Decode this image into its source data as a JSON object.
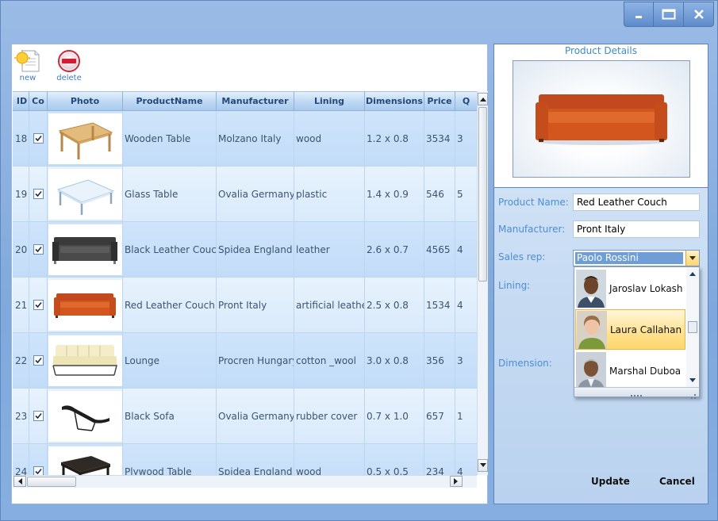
{
  "window": {
    "controls": [
      {
        "icon": "minimize-icon"
      },
      {
        "icon": "maximize-icon"
      },
      {
        "icon": "close-icon"
      }
    ]
  },
  "toolbar": {
    "new_label": "new",
    "delete_label": "delete"
  },
  "grid": {
    "columns": [
      "ID",
      "Co",
      "Photo",
      "ProductName",
      "Manufacturer",
      "Lining",
      "Dimensions",
      "Price",
      "Q"
    ],
    "rows": [
      {
        "id": "18",
        "checked": true,
        "photo": "wooden-table-image",
        "name": "Wooden Table",
        "manufacturer": "Molzano Italy",
        "lining": "wood",
        "dimensions": "1.2 x 0.8",
        "price": "3534",
        "q": "3"
      },
      {
        "id": "19",
        "checked": true,
        "photo": "glass-table-image",
        "name": "Glass Table",
        "manufacturer": "Ovalia Germany",
        "lining": "plastic",
        "dimensions": "1.4 x 0.9",
        "price": "546",
        "q": "5"
      },
      {
        "id": "20",
        "checked": true,
        "photo": "black-couch-image",
        "name": "Black Leather Couch",
        "manufacturer": "Spidea England",
        "lining": "leather",
        "dimensions": "2.6 x 0.7",
        "price": "4565",
        "q": "4"
      },
      {
        "id": "21",
        "checked": true,
        "photo": "red-couch-image",
        "name": "Red Leather Couch",
        "manufacturer": "Pront Italy",
        "lining": "artificial leather",
        "dimensions": "2.5 x 0.8",
        "price": "1534",
        "q": "4"
      },
      {
        "id": "22",
        "checked": true,
        "photo": "lounge-image",
        "name": "Lounge",
        "manufacturer": "Procren Hungary",
        "lining": "cotton _wool",
        "dimensions": "3.0 x 0.8",
        "price": "356",
        "q": "3"
      },
      {
        "id": "23",
        "checked": true,
        "photo": "black-sofa-image",
        "name": "Black Sofa",
        "manufacturer": "Ovalia Germany",
        "lining": "rubber cover",
        "dimensions": "0.7 x 1.0",
        "price": "657",
        "q": "1"
      },
      {
        "id": "24",
        "checked": true,
        "photo": "plywood-table-image",
        "name": "Plywood Table",
        "manufacturer": "Spidea England",
        "lining": "wood",
        "dimensions": "0.5 x 0.5",
        "price": "234",
        "q": "4"
      }
    ]
  },
  "details": {
    "title": "Product Details",
    "image": "red-couch-image",
    "product_name_label": "Product Name:",
    "product_name_value": "Red Leather Couch",
    "manufacturer_label": "Manufacturer:",
    "manufacturer_value": "Pront Italy",
    "sales_rep_label": "Sales rep:",
    "sales_rep_value": "Paolo Rossini",
    "lining_label": "Lining:",
    "dimension_label": "Dimension:",
    "sales_rep_options": [
      {
        "name": "Jaroslav Lokash",
        "selected": false
      },
      {
        "name": "Laura Callahan",
        "selected": true
      },
      {
        "name": "Marshal Duboa",
        "selected": false
      }
    ],
    "update_label": "Update",
    "cancel_label": "Cancel"
  }
}
